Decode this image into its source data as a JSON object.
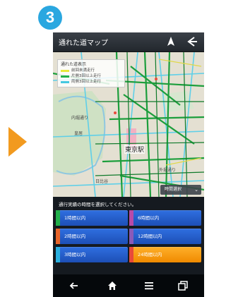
{
  "step": {
    "number": "3"
  },
  "app": {
    "title": "通れた道マップ"
  },
  "legend": {
    "title": "通れた道表示",
    "items": [
      {
        "label": "前回未満走行",
        "color": "#e8e83a"
      },
      {
        "label": "片側3回以上走行",
        "color": "#22b04a"
      },
      {
        "label": "両側3回以上走行",
        "color": "#44c8e0"
      }
    ]
  },
  "map": {
    "labels": [
      "皇居",
      "内堀通り",
      "外堀通り",
      "日比谷"
    ],
    "station": "東京駅"
  },
  "time_select": {
    "label": "時間選択",
    "chevron": "⌄"
  },
  "panel": {
    "prompt": "通行実績の時間を選択してください。",
    "buttons": [
      {
        "label": "1時間以内",
        "color": "#22b04a",
        "selected": false
      },
      {
        "label": "6時間以内",
        "color": "#b84aa8",
        "selected": false
      },
      {
        "label": "2時間以内",
        "color": "#e8652a",
        "selected": false
      },
      {
        "label": "12時間以内",
        "color": "#8a5ab8",
        "selected": false
      },
      {
        "label": "3時間以内",
        "color": "#2ab0e0",
        "selected": false
      },
      {
        "label": "24時間以内",
        "color": "#e84a3a",
        "selected": true
      }
    ]
  },
  "navbar": {
    "items": [
      "back-icon",
      "home-icon",
      "menu-icon",
      "recent-apps-icon"
    ]
  }
}
